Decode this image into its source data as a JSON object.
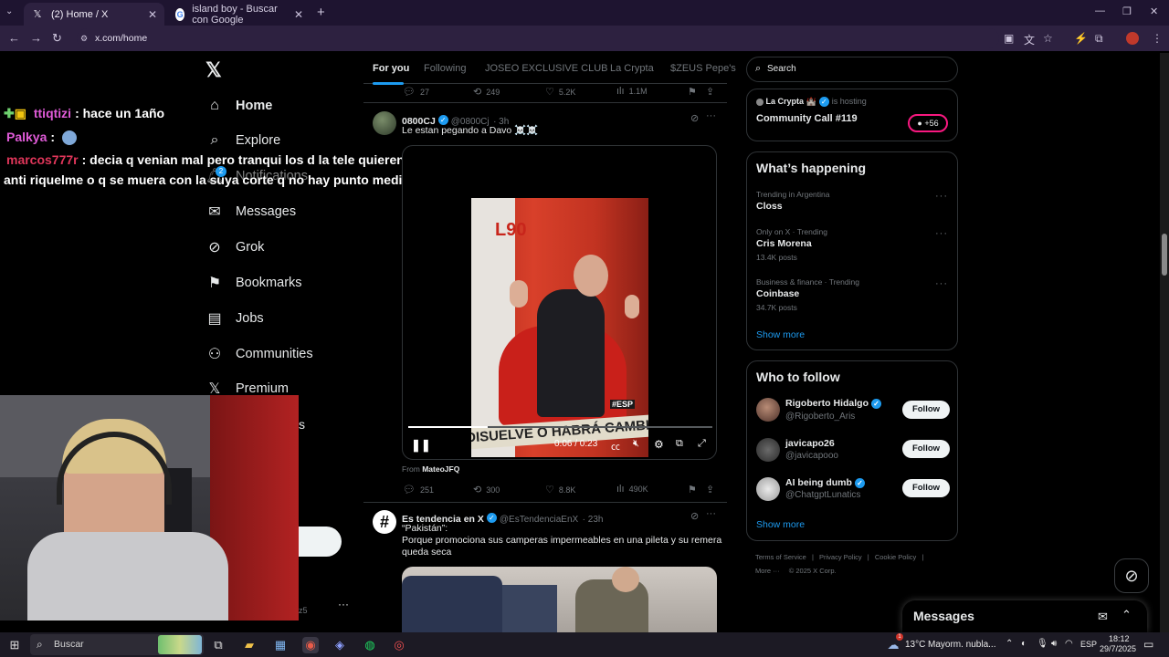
{
  "browser": {
    "tabs": [
      {
        "label": "(2) Home / X",
        "icon": "x-logo-icon",
        "active": true
      },
      {
        "label": "island boy - Buscar con Google",
        "icon": "google-icon",
        "active": false
      }
    ],
    "url": "x.com/home"
  },
  "x_nav": {
    "items": [
      {
        "label": "Home",
        "icon": "home-icon"
      },
      {
        "label": "Explore",
        "icon": "search-icon"
      },
      {
        "label": "Notifications",
        "icon": "bell-icon",
        "badge": "2"
      },
      {
        "label": "Messages",
        "icon": "mail-icon"
      },
      {
        "label": "Grok",
        "icon": "grok-icon"
      },
      {
        "label": "Bookmarks",
        "icon": "bookmark-icon"
      },
      {
        "label": "Jobs",
        "icon": "briefcase-icon"
      },
      {
        "label": "Communities",
        "icon": "people-icon"
      },
      {
        "label": "Premium",
        "icon": "x-logo-icon"
      }
    ],
    "more_partial": "s",
    "account_partial": "z5"
  },
  "chat": [
    {
      "user": "ttiqtizi",
      "message": ": hace un 1año",
      "color": "#e05bd8"
    },
    {
      "user": "Palkya",
      "message": ":",
      "color": "#e05bd8"
    },
    {
      "user": "marcos777r",
      "message": ": decia q venian mal pero tranqui los d la tele quieren q sea ultra",
      "color": "#e0365a"
    },
    {
      "user": "",
      "message": "anti riquelme o q se muera con la suya corte q no hay punto medio",
      "color": "#ffffff"
    }
  ],
  "timeline": {
    "tabs": [
      "For you",
      "Following",
      "JOSEO EXCLUSIVE CLUB",
      "La Crypta",
      "$ZEUS Pepe's"
    ],
    "prev_actions": {
      "replies": "27",
      "reposts": "249",
      "likes": "5.2K",
      "views": "1.1M"
    },
    "tweet1": {
      "name": "0800CJ",
      "handle": "@0800Cj",
      "time": "· 3h",
      "text": "Le estan pegando a Davo ☠️☠️",
      "video": {
        "time": "0:06 / 0:23",
        "banner": "DISUELVE O HABRÁ CAMBIOS?",
        "channel": "L90",
        "tag": "#ESP",
        "progress": 0.26
      },
      "from_label": "From",
      "from_user": "MateoJFQ",
      "actions": {
        "replies": "251",
        "reposts": "300",
        "likes": "8.8K",
        "views": "490K"
      }
    },
    "tweet2": {
      "name": "Es tendencia en X",
      "handle": "@EsTendenciaEnX",
      "time": "· 23h",
      "line1": "“Pakistán”:",
      "line2": "Porque promociona sus camperas impermeables en una pileta y su remera",
      "line3": "queda seca"
    }
  },
  "right": {
    "search_placeholder": "Search",
    "space": {
      "host": "La Crypta 🏰",
      "is_hosting": "is hosting",
      "title": "Community Call #119",
      "count": "+56"
    },
    "happening": {
      "title": "What’s happening",
      "trends": [
        {
          "meta": "Trending in Argentina",
          "name": "Closs",
          "posts": ""
        },
        {
          "meta": "Only on X · Trending",
          "name": "Cris Morena",
          "posts": "13.4K posts"
        },
        {
          "meta": "Business & finance · Trending",
          "name": "Coinbase",
          "posts": "34.7K posts"
        }
      ],
      "show_more": "Show more"
    },
    "who_to_follow": {
      "title": "Who to follow",
      "accounts": [
        {
          "name": "Rigoberto Hidalgo",
          "handle": "@Rigoberto_Aris",
          "verified": true
        },
        {
          "name": "javicapo26",
          "handle": "@javicapooo",
          "verified": false
        },
        {
          "name": "AI being dumb",
          "handle": "@ChatgptLunatics",
          "verified": true
        }
      ],
      "follow_label": "Follow",
      "show_more": "Show more"
    },
    "footer": {
      "terms": "Terms of Service",
      "privacy": "Privacy Policy",
      "cookie": "Cookie Policy",
      "more": "More ···",
      "copyright": "© 2025 X Corp."
    },
    "messages_title": "Messages"
  },
  "taskbar": {
    "search": "Buscar",
    "weather": "13°C",
    "weather_desc": "Mayorm. nubla...",
    "lang": "ESP",
    "time": "18:12",
    "date": "29/7/2025",
    "weather_badge": "1"
  },
  "colors": {
    "accent": "#1d9bf0",
    "chrome": "#2d2140",
    "tabbar": "#1e1430"
  }
}
